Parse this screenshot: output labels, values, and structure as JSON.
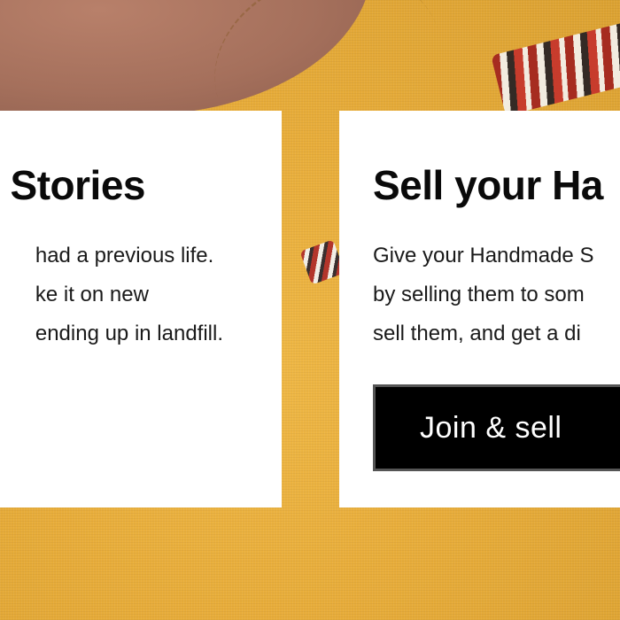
{
  "background": {
    "image_name": "yellow-embroidered-garment-photo",
    "colors": {
      "fabric": "#e8ad3a",
      "skin": "#a5705c",
      "embroidery_red": "#a3261f"
    }
  },
  "cards": [
    {
      "title": "Stories",
      "lines": [
        "had a previous life.",
        "ke it on new",
        "ending up in landfill."
      ]
    },
    {
      "title": "Sell your Ha",
      "lines": [
        "Give your Handmade S",
        "by selling them to som",
        "sell them, and get a di"
      ],
      "button_label": "Join & sell"
    }
  ],
  "colors": {
    "card_bg": "#ffffff",
    "button_bg": "#000000",
    "button_text": "#ffffff"
  }
}
